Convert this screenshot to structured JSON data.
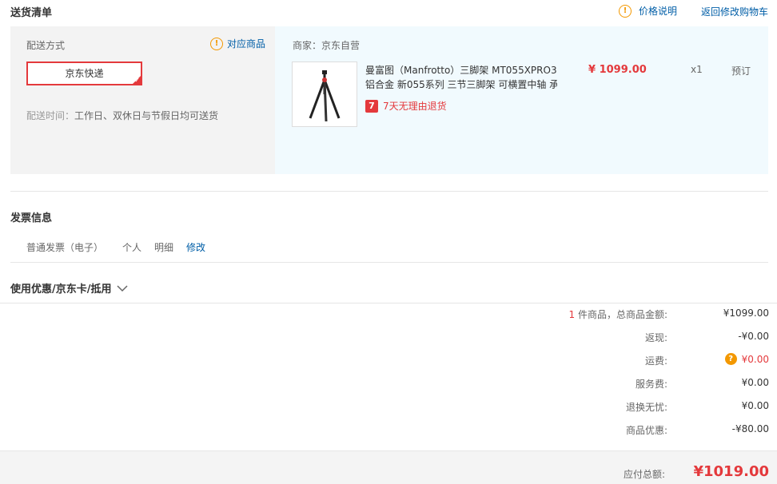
{
  "header": {
    "title": "送货清单",
    "price_note_icon": "!",
    "price_note": "价格说明",
    "back_to_cart": "返回修改购物车"
  },
  "shipping": {
    "method_label": "配送方式",
    "related_goods_icon": "!",
    "related_goods": "对应商品",
    "express_option": "京东快递",
    "time_label": "配送时间：",
    "time_value": "工作日、双休日与节假日均可送货"
  },
  "goods": {
    "seller": "商家：京东自营",
    "items": [
      {
        "name_line1": "曼富图（Manfrotto）三脚架 MT055XPRO3",
        "name_line2": "铝合金 新055系列 三节三脚架 可横置中轴 承",
        "price": "¥ 1099.00",
        "qty": "x1",
        "status": "预订",
        "return_badge": "7",
        "return_policy": "7天无理由退货"
      }
    ]
  },
  "invoice": {
    "title": "发票信息",
    "type": "普通发票（电子）",
    "holder": "个人",
    "content": "明细",
    "edit": "修改"
  },
  "coupon": {
    "title": "使用优惠/京东卡/抵用"
  },
  "summary": {
    "count": "1",
    "count_suffix": " 件商品，总商品金额:",
    "goods_total": "¥1099.00",
    "rebate_label": "返现:",
    "rebate": "-¥0.00",
    "freight_label": "运费:",
    "freight": "¥0.00",
    "service_label": "服务费:",
    "service": "¥0.00",
    "return_ins_label": "退换无忧:",
    "return_ins": "¥0.00",
    "discount_label": "商品优惠:",
    "discount": "-¥80.00",
    "payable_label": "应付总额:",
    "payable": "¥1019.00"
  },
  "colors": {
    "accent_red": "#e4393c",
    "link_blue": "#005ea7",
    "warn_orange": "#f39800"
  }
}
